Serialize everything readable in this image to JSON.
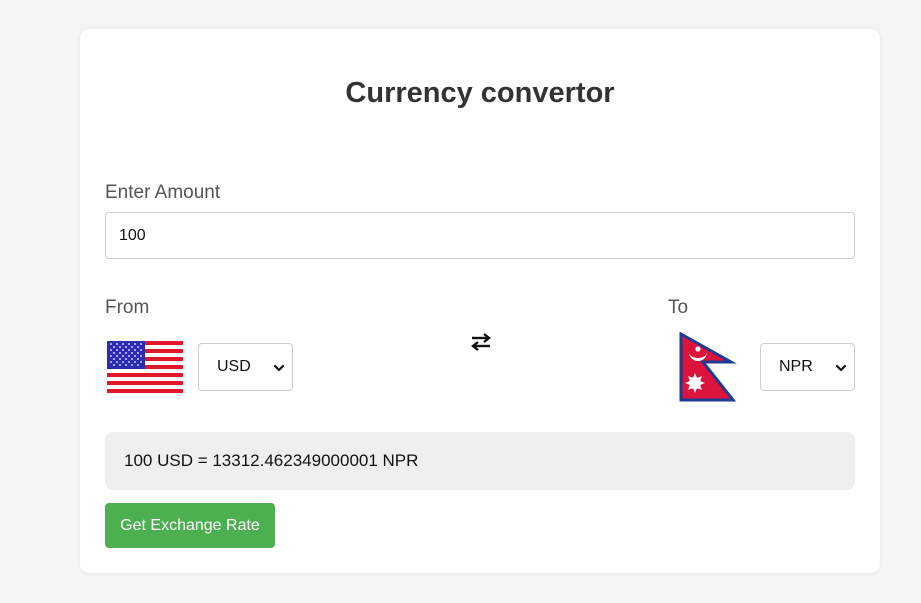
{
  "title": "Currency convertor",
  "amount": {
    "label": "Enter Amount",
    "value": "100"
  },
  "from": {
    "label": "From",
    "currency": "USD",
    "flag": "us-flag-icon"
  },
  "to": {
    "label": "To",
    "currency": "NPR",
    "flag": "nepal-flag-icon"
  },
  "swap_icon": "swap-arrows-icon",
  "result": {
    "text": "100 USD = 13312.462349000001 NPR"
  },
  "button": {
    "label": "Get Exchange Rate"
  },
  "colors": {
    "button_bg": "#4caf50",
    "result_bg": "#efefef",
    "page_bg": "#f6f6f6"
  }
}
